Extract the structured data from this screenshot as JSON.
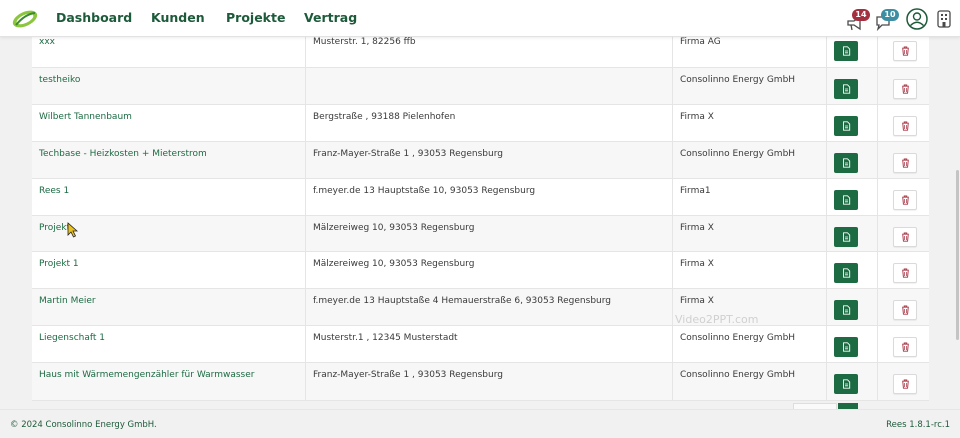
{
  "colors": {
    "brand_green": "#1d6b43",
    "nav_text": "#1d5a3a",
    "badge_red": "#a33040",
    "badge_teal": "#3e8ea3"
  },
  "nav": {
    "items": [
      {
        "label": "Dashboard"
      },
      {
        "label": "Kunden"
      },
      {
        "label": "Projekte"
      },
      {
        "label": "Vertrag"
      }
    ],
    "notification_count": "14",
    "message_count": "10"
  },
  "rows": [
    {
      "name": "xxx",
      "address": "Musterstr. 1, 82256 ffb",
      "company": "Firma AG"
    },
    {
      "name": "testheiko",
      "address": "",
      "company": "Consolinno Energy GmbH"
    },
    {
      "name": "Wilbert Tannenbaum",
      "address": "Bergstraße , 93188 Pielenhofen",
      "company": "Firma X"
    },
    {
      "name": "Techbase - Heizkosten + Mieterstrom",
      "address": "Franz-Mayer-Straße 1 , 93053 Regensburg",
      "company": "Consolinno Energy GmbH"
    },
    {
      "name": "Rees 1",
      "address": "f.meyer.de 13 Hauptstaße 10, 93053 Regensburg",
      "company": "Firma1"
    },
    {
      "name": "Projekt",
      "address": "Mälzereiweg 10, 93053 Regensburg",
      "company": "Firma X"
    },
    {
      "name": "Projekt 1",
      "address": "Mälzereiweg 10, 93053 Regensburg",
      "company": "Firma X"
    },
    {
      "name": "Martin Meier",
      "address": "f.meyer.de 13 Hauptstaße 4 Hemauerstraße 6, 93053 Regensburg",
      "company": "Firma X"
    },
    {
      "name": "Liegenschaft 1",
      "address": "Musterstr.1 , 12345 Musterstadt",
      "company": "Consolinno Energy GmbH"
    },
    {
      "name": "Haus mit Wärmemengenzähler für Warmwasser",
      "address": "Franz-Mayer-Straße 1 , 93053 Regensburg",
      "company": "Consolinno Energy GmbH"
    }
  ],
  "watermark": "Video2PPT.com",
  "footer": {
    "copyright": "© 2024 Consolinno Energy GmbH.",
    "version": "Rees 1.8.1-rc.1"
  }
}
